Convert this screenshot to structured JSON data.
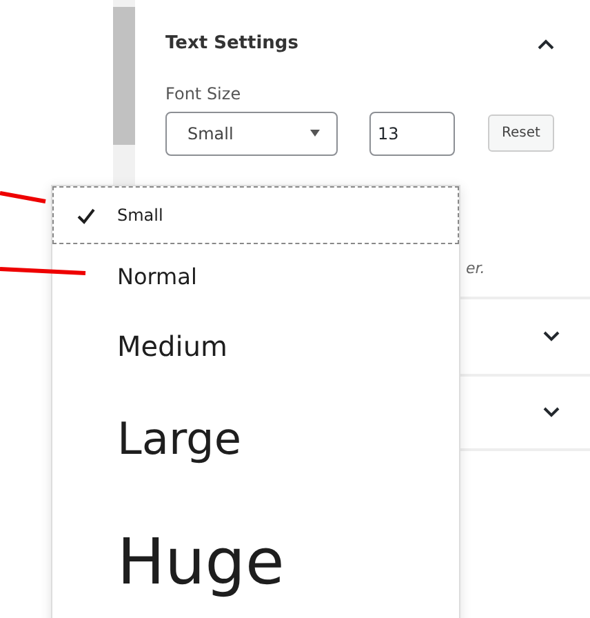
{
  "panel": {
    "title": "Text Settings",
    "expanded": true,
    "font_size": {
      "label": "Font Size",
      "select_value": "Small",
      "number_value": "13",
      "reset": "Reset"
    },
    "partial_text": "er.",
    "sections": [
      {
        "expanded": false
      },
      {
        "expanded": false
      }
    ]
  },
  "dropdown": {
    "options": [
      {
        "label": "Small",
        "kind": "small",
        "selected": true
      },
      {
        "label": "Normal",
        "kind": "normal",
        "selected": false
      },
      {
        "label": "Medium",
        "kind": "medium",
        "selected": false
      },
      {
        "label": "Large",
        "kind": "large",
        "selected": false
      },
      {
        "label": "Huge",
        "kind": "huge",
        "selected": false
      }
    ]
  },
  "annotations": [
    {
      "kind": "line"
    },
    {
      "kind": "line"
    }
  ]
}
